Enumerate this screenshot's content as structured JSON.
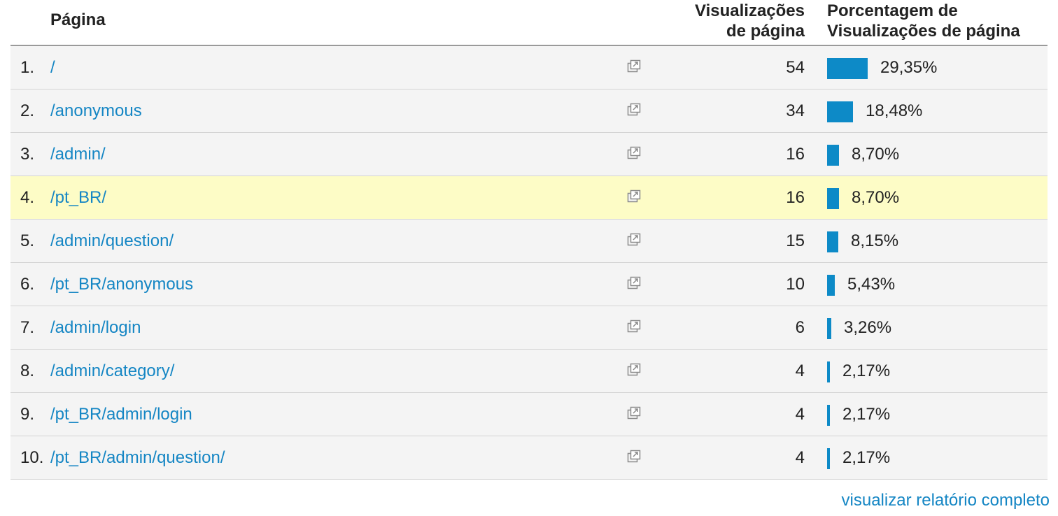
{
  "header": {
    "page_label": "Página",
    "views_label_line1": "Visualizações",
    "views_label_line2": "de página",
    "pct_label_line1": "Porcentagem de",
    "pct_label_line2": "Visualizações de página"
  },
  "rows": [
    {
      "rank": "1.",
      "page": "/",
      "views": "54",
      "pct": "29,35%",
      "pct_value": 29.35
    },
    {
      "rank": "2.",
      "page": "/anonymous",
      "views": "34",
      "pct": "18,48%",
      "pct_value": 18.48
    },
    {
      "rank": "3.",
      "page": "/admin/",
      "views": "16",
      "pct": "8,70%",
      "pct_value": 8.7
    },
    {
      "rank": "4.",
      "page": "/pt_BR/",
      "views": "16",
      "pct": "8,70%",
      "pct_value": 8.7
    },
    {
      "rank": "5.",
      "page": "/admin/question/",
      "views": "15",
      "pct": "8,15%",
      "pct_value": 8.15
    },
    {
      "rank": "6.",
      "page": "/pt_BR/anonymous",
      "views": "10",
      "pct": "5,43%",
      "pct_value": 5.43
    },
    {
      "rank": "7.",
      "page": "/admin/login",
      "views": "6",
      "pct": "3,26%",
      "pct_value": 3.26
    },
    {
      "rank": "8.",
      "page": "/admin/category/",
      "views": "4",
      "pct": "2,17%",
      "pct_value": 2.17
    },
    {
      "rank": "9.",
      "page": "/pt_BR/admin/login",
      "views": "4",
      "pct": "2,17%",
      "pct_value": 2.17
    },
    {
      "rank": "10.",
      "page": "/pt_BR/admin/question/",
      "views": "4",
      "pct": "2,17%",
      "pct_value": 2.17
    }
  ],
  "highlighted_row_index": 3,
  "footer": {
    "full_report_label": "visualizar relatório completo"
  },
  "colors": {
    "link": "#1586c4",
    "bar": "#0d8ac7",
    "highlight": "#fdfcc6",
    "row_bg": "#f4f4f4"
  }
}
